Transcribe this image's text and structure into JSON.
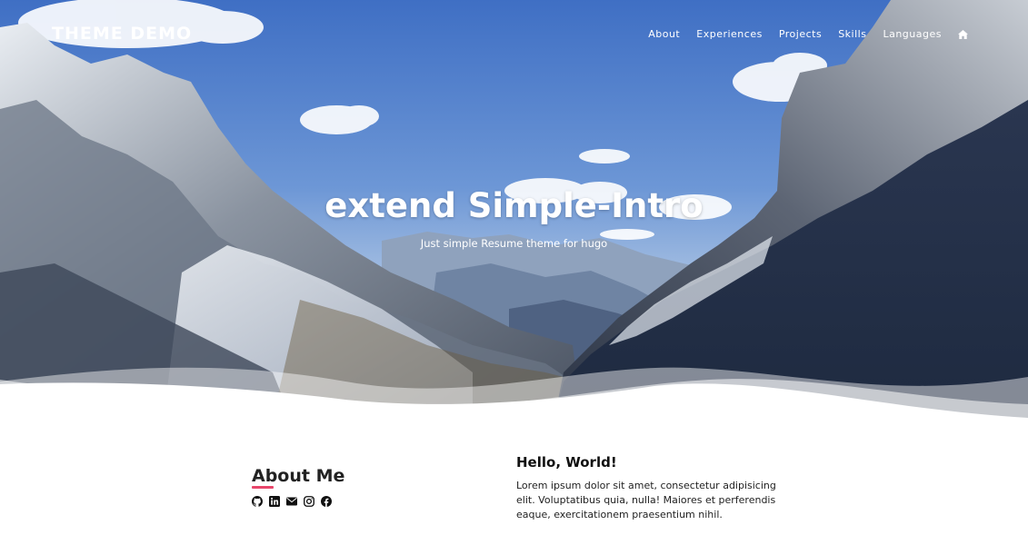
{
  "brand": {
    "title": "THEME DEMO"
  },
  "nav": {
    "items": [
      {
        "label": "About"
      },
      {
        "label": "Experiences"
      },
      {
        "label": "Projects"
      },
      {
        "label": "Skills"
      },
      {
        "label": "Languages"
      }
    ],
    "home_icon": "home-icon"
  },
  "hero": {
    "title": "extend Simple-Intro",
    "subtitle": "Just simple Resume theme for hugo"
  },
  "about": {
    "heading": "About Me",
    "accent_color": "#e8466b",
    "social_icons": [
      "github-icon",
      "linkedin-icon",
      "email-icon",
      "instagram-icon",
      "facebook-icon"
    ]
  },
  "intro": {
    "heading": "Hello, World!",
    "text": "Lorem ipsum dolor sit amet, consectetur adipisicing elit. Voluptatibus quia, nulla! Maiores et perferendis eaque, exercitationem praesentium nihil."
  }
}
